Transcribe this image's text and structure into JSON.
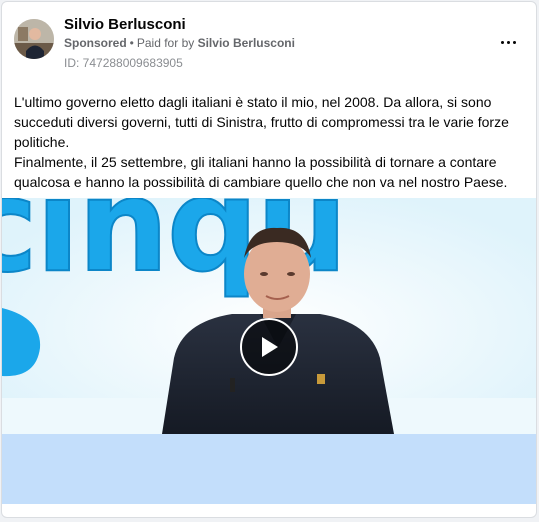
{
  "post": {
    "author_name": "Silvio Berlusconi",
    "sponsored_label": "Sponsored",
    "paid_for_prefix": "Paid for by",
    "paid_for_name": "Silvio Berlusconi",
    "ad_id": "ID: 747288009683905",
    "text_paragraphs": [
      "L'ultimo governo eletto dagli italiani è stato il mio, nel 2008. Da allora, si sono succeduti diversi governi, tutti di Sinistra, frutto di compromessi tra le varie forze politiche.",
      "Finalmente, il 25 settembre, gli italiani hanno la possibilità di tornare a contare qualcosa e hanno la possibilità di cambiare quello che non va nel nostro Paese."
    ]
  },
  "media": {
    "background_word": "cinqu",
    "play_icon": "play-icon"
  },
  "colors": {
    "page_bg": "#f0f2f5",
    "secondary_text": "#65676b",
    "studio_blue": "#1aa6e8",
    "media_footer": "#c3defb"
  }
}
